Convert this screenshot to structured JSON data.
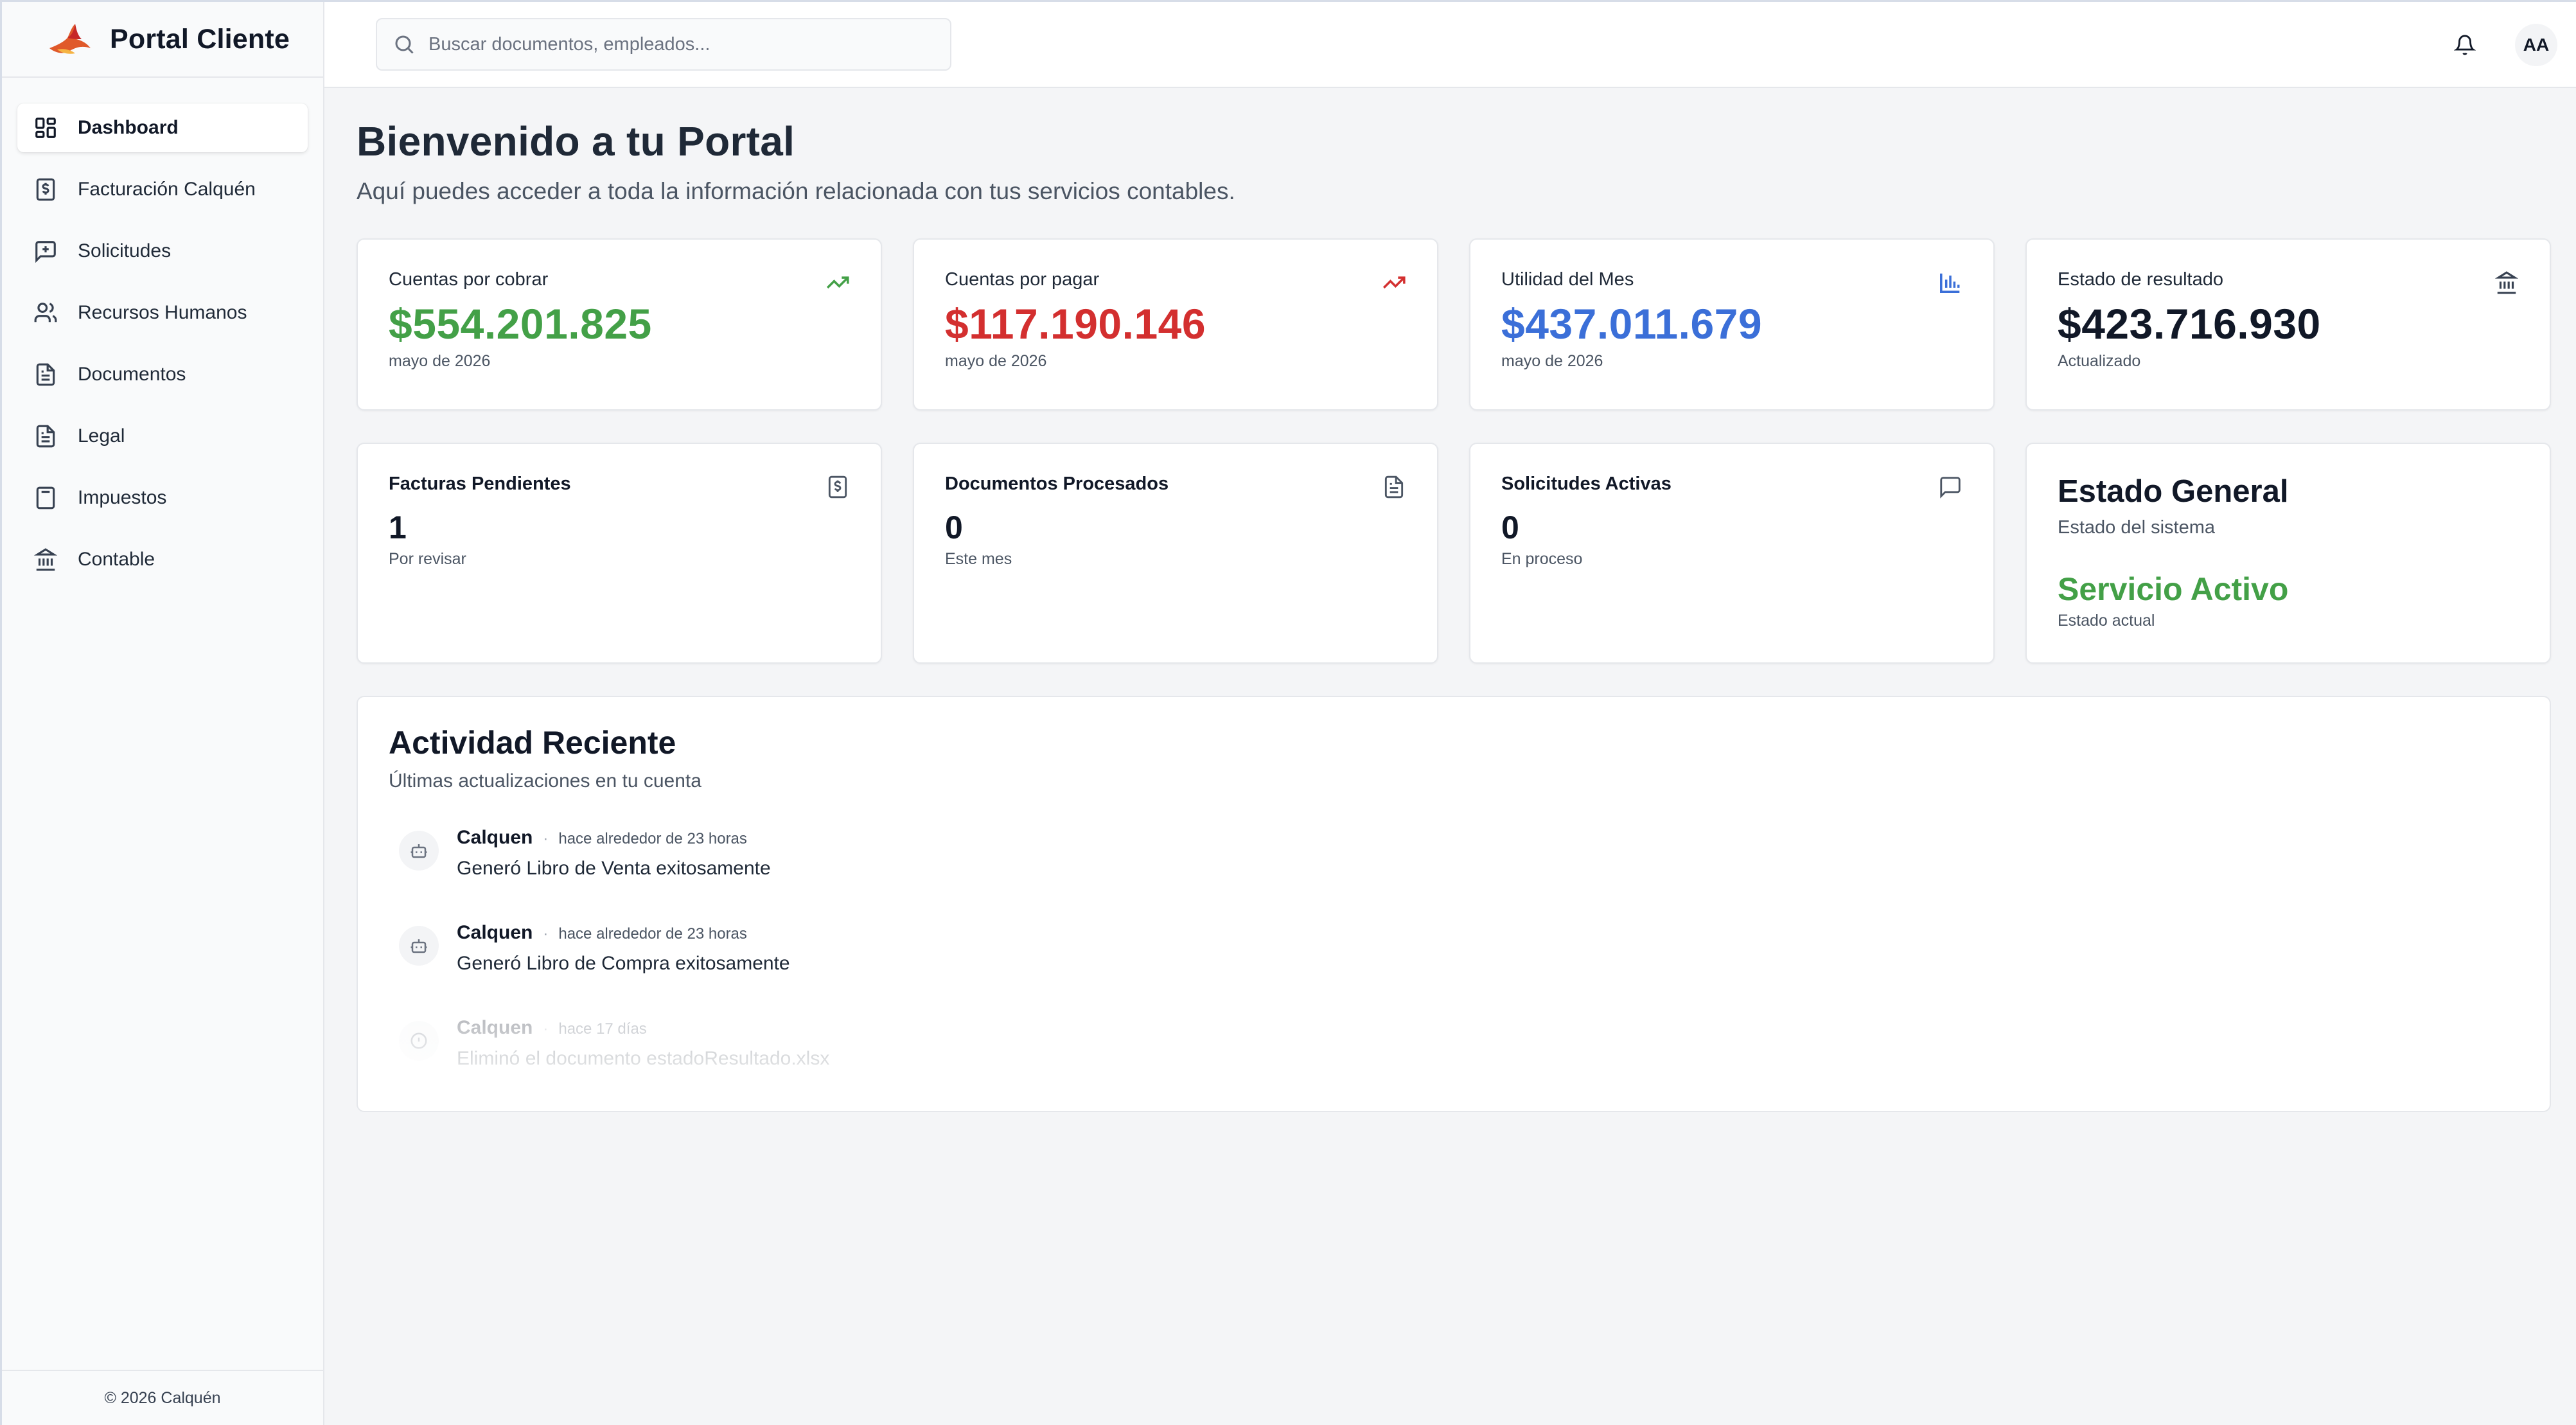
{
  "brand": {
    "name": "Portal Cliente",
    "logo": "calquen-bird-logo"
  },
  "sidebar": {
    "items": [
      {
        "label": "Dashboard",
        "icon": "dashboard-icon",
        "active": true
      },
      {
        "label": "Facturación Calquén",
        "icon": "invoice-dollar-icon"
      },
      {
        "label": "Solicitudes",
        "icon": "message-plus-icon"
      },
      {
        "label": "Recursos Humanos",
        "icon": "users-icon"
      },
      {
        "label": "Documentos",
        "icon": "document-icon"
      },
      {
        "label": "Legal",
        "icon": "document-icon"
      },
      {
        "label": "Impuestos",
        "icon": "calculator-icon"
      },
      {
        "label": "Contable",
        "icon": "bank-icon"
      }
    ],
    "footer": "© 2026 Calquén"
  },
  "topbar": {
    "search_placeholder": "Buscar documentos, empleados...",
    "search_value": "",
    "avatar_initials": "AA"
  },
  "page": {
    "title": "Bienvenido a tu Portal",
    "subtitle": "Aquí puedes acceder a toda la información relacionada con tus servicios contables."
  },
  "stats": [
    {
      "label": "Cuentas por cobrar",
      "value": "$554.201.825",
      "sub": "mayo de 2026",
      "color": "#43a047",
      "icon": "trending-up-icon"
    },
    {
      "label": "Cuentas por pagar",
      "value": "$117.190.146",
      "sub": "mayo de 2026",
      "color": "#d32f2f",
      "icon": "trending-up-icon"
    },
    {
      "label": "Utilidad del Mes",
      "value": "$437.011.679",
      "sub": "mayo de 2026",
      "color": "#3b6fd8",
      "icon": "bar-chart-icon"
    },
    {
      "label": "Estado de resultado",
      "value": "$423.716.930",
      "sub": "Actualizado",
      "color": "#111827",
      "icon": "bank-icon"
    }
  ],
  "counters": [
    {
      "label": "Facturas Pendientes",
      "value": "1",
      "sub": "Por revisar",
      "icon": "invoice-dollar-icon"
    },
    {
      "label": "Documentos Procesados",
      "value": "0",
      "sub": "Este mes",
      "icon": "document-icon"
    },
    {
      "label": "Solicitudes Activas",
      "value": "0",
      "sub": "En proceso",
      "icon": "message-icon"
    }
  ],
  "status": {
    "title": "Estado General",
    "subtitle": "Estado del sistema",
    "value": "Servicio Activo",
    "note": "Estado actual",
    "color": "#43a047"
  },
  "activity": {
    "title": "Actividad Reciente",
    "subtitle": "Últimas actualizaciones en tu cuenta",
    "items": [
      {
        "user": "Calquen",
        "time": "hace alrededor de 23 horas",
        "desc": "Generó Libro de Venta exitosamente",
        "icon": "bot-icon"
      },
      {
        "user": "Calquen",
        "time": "hace alrededor de 23 horas",
        "desc": "Generó Libro de Compra exitosamente",
        "icon": "bot-icon"
      },
      {
        "user": "Calquen",
        "time": "hace 17 días",
        "desc": "Eliminó el documento estadoResultado.xlsx",
        "icon": "info-icon"
      }
    ]
  }
}
